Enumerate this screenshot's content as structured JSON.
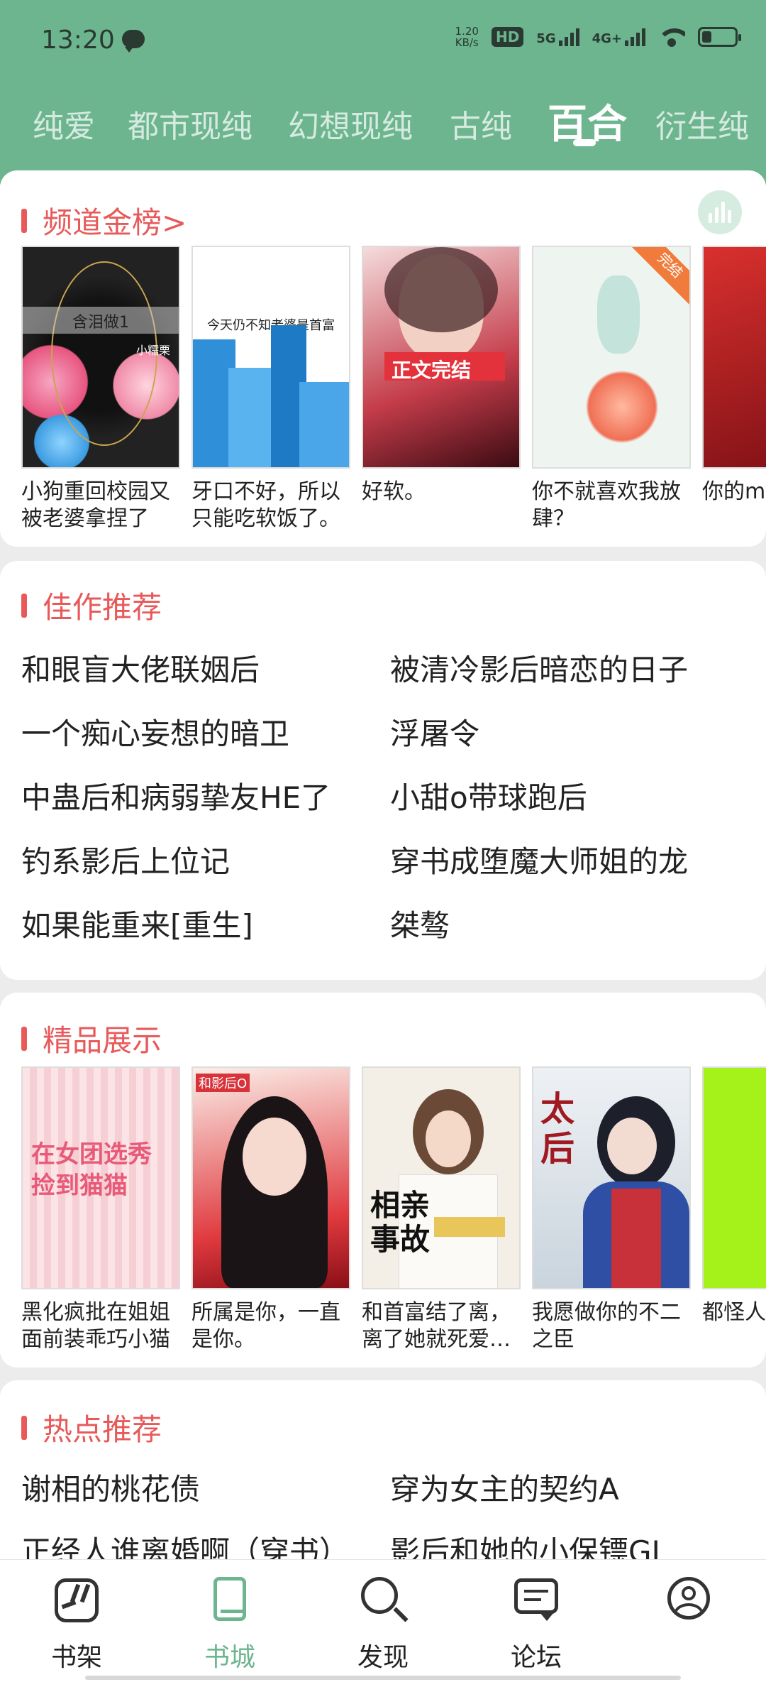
{
  "status": {
    "time": "13:20",
    "netspeed_top": "1.20",
    "netspeed_bottom": "KB/s",
    "hd": "HD",
    "net1": "5G",
    "net2": "4G+",
    "battery_level": 0.3
  },
  "tabs": [
    "纯爱",
    "都市现纯",
    "幻想现纯",
    "古纯",
    "百合",
    "衍生纯"
  ],
  "active_tab": "百合",
  "sections": {
    "channel_rank": {
      "title": "频道金榜>",
      "books": [
        {
          "title": "小狗重回校园又被老婆拿捏了",
          "cover_text": "含泪做1",
          "cover_sub": "小糯栗"
        },
        {
          "title": "牙口不好，所以只能吃软饭了。",
          "cover_text": "今天仍不知老婆是首富"
        },
        {
          "title": "好软。",
          "cover_text": "正文完结"
        },
        {
          "title": "你不就喜欢我放肆？",
          "cover_text": "完结"
        },
        {
          "title": "你的mine",
          "cover_text": ""
        }
      ]
    },
    "recommend": {
      "title": "佳作推荐",
      "items": [
        "和眼盲大佬联姻后",
        "被清冷影后暗恋的日子",
        "一个痴心妄想的暗卫",
        "浮屠令",
        "中蛊后和病弱挚友HE了",
        "小甜o带球跑后",
        "钓系影后上位记",
        "穿书成堕魔大师姐的龙",
        "如果能重来[重生]",
        "桀骜"
      ]
    },
    "featured": {
      "title": "精品展示",
      "books": [
        {
          "title": "黑化疯批在姐姐面前装乖巧小猫",
          "cover_text": "在女团选秀捡到猫猫"
        },
        {
          "title": "所属是你，一直是你。",
          "cover_text": "和影后O"
        },
        {
          "title": "和首富结了离，离了她就死爱…",
          "cover_text": "相亲事故"
        },
        {
          "title": "我愿做你的不二之臣",
          "cover_text": "太后"
        },
        {
          "title": "都怪人!",
          "cover_text": ""
        }
      ]
    },
    "hot": {
      "title": "热点推荐",
      "items": [
        "谢相的桃花债",
        "穿为女主的契约A",
        "正经人谁离婚啊（穿书）",
        "影后和她的小保镖GL"
      ]
    }
  },
  "bottom_nav": [
    {
      "label": "书架",
      "icon": "bookshelf-icon"
    },
    {
      "label": "书城",
      "icon": "bookstore-icon"
    },
    {
      "label": "发现",
      "icon": "search-icon"
    },
    {
      "label": "论坛",
      "icon": "forum-icon"
    },
    {
      "label": "",
      "icon": "profile-icon"
    }
  ],
  "colors": {
    "brand": "#6cb58f",
    "accent": "#e85a5a"
  }
}
